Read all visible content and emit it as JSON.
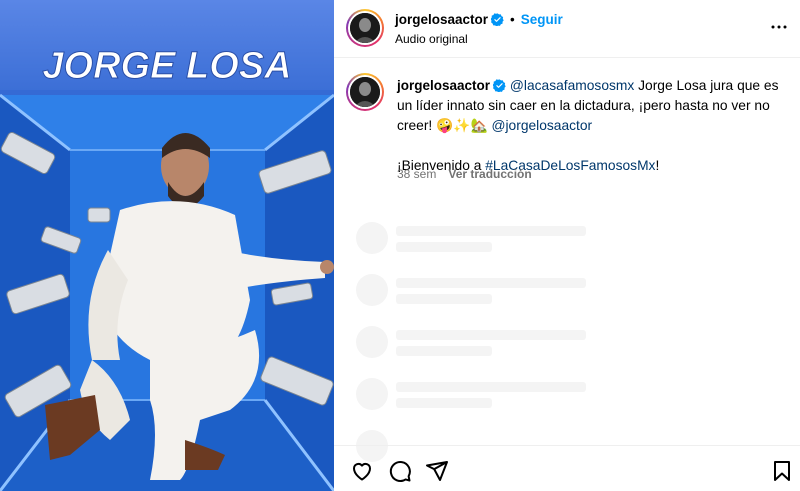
{
  "media": {
    "overlay_title": "JORGE LOSA"
  },
  "header": {
    "username": "jorgelosaactor",
    "separator": "•",
    "follow_label": "Seguir",
    "subtitle": "Audio original"
  },
  "caption": {
    "username": "jorgelosaactor",
    "mention1": "@lacasafamososmx",
    "text1": " Jorge Losa jura que es un líder innato sin caer en la dictadura, ¡pero hasta no ver no creer! 🤪✨🏡 ",
    "mention2": "@jorgelosaactor",
    "text2": "¡Bienvenido a ",
    "hashtag": "#LaCasaDeLosFamososMx",
    "text3": "!",
    "age": "38 sem",
    "translate_label": "Ver traducción"
  },
  "icons": {
    "verified": "verified-badge-icon",
    "more": "more-options-icon",
    "like": "heart-icon",
    "comment": "comment-icon",
    "share": "share-icon",
    "save": "bookmark-icon"
  },
  "colors": {
    "accent": "#0095f6",
    "link": "#00376b",
    "secondary_text": "#737373",
    "media_blue": "#1f5fc8"
  }
}
